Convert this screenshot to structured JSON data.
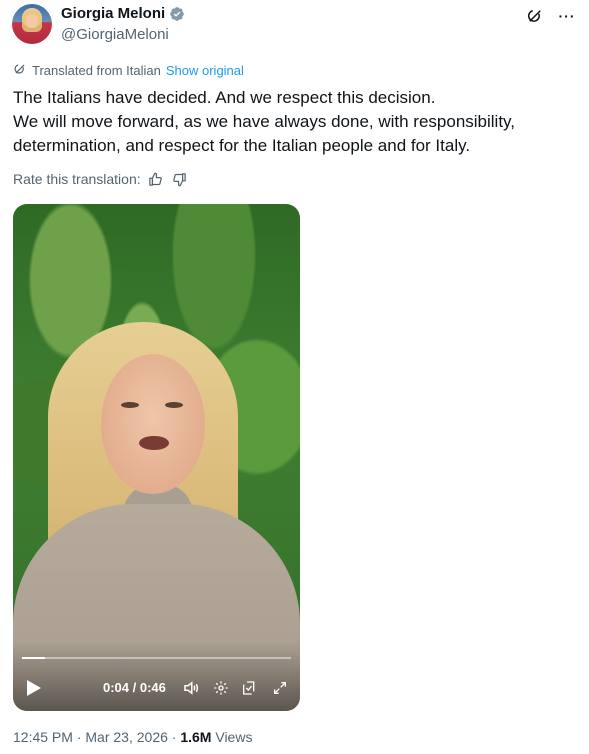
{
  "author": {
    "display_name": "Giorgia Meloni",
    "handle": "@GiorgiaMeloni",
    "verified_icon": "verified-badge-icon"
  },
  "header_icons": [
    "grok-icon",
    "more-icon"
  ],
  "more_label": "···",
  "translation": {
    "note": "Translated from Italian",
    "show_original": "Show original"
  },
  "tweet": {
    "lines": [
      "The Italians have decided. And we respect this decision.",
      "We will move forward, as we have always done, with responsibility,",
      "determination, and respect for the Italian people and for Italy."
    ]
  },
  "rate": {
    "label": "Rate this translation:"
  },
  "video": {
    "time": "0:04 / 0:46",
    "progress": 0.087,
    "controls": [
      "play-icon",
      "volume-icon",
      "settings-icon",
      "captions-icon",
      "fullscreen-icon"
    ]
  },
  "meta": {
    "time": "12:45 PM",
    "date": "Mar 23, 2026",
    "views": "1.6M",
    "views_label": "Views",
    "sep": "·"
  },
  "colors": {
    "link": "#1d9bf0",
    "muted": "#536471",
    "text": "#0f1419"
  }
}
